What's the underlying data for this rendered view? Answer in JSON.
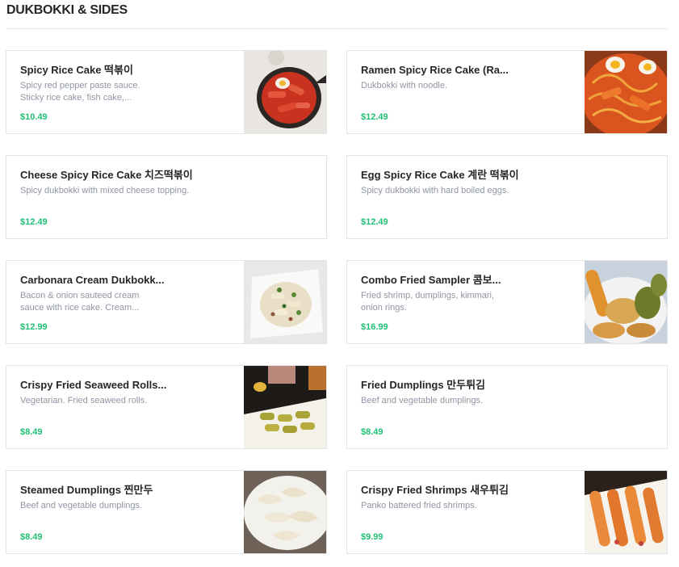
{
  "section": {
    "title": "DUKBOKKI & SIDES"
  },
  "colors": {
    "price": "#1fbf75",
    "border": "#e4e4e4",
    "desc": "#8f95a3"
  },
  "items": [
    {
      "name": "Spicy Rice Cake 떡볶이",
      "desc": "Spicy red pepper paste sauce. Sticky rice cake, fish cake,...",
      "price": "$10.49",
      "image": "tteokbokki-pan-photo"
    },
    {
      "name": "Ramen Spicy Rice Cake (Ra...",
      "desc": "Dukbokki with noodle.",
      "price": "$12.49",
      "image": "rabokki-photo"
    },
    {
      "name": "Cheese Spicy Rice Cake 치즈떡볶이",
      "desc": "Spicy dukbokki with mixed cheese topping.",
      "price": "$12.49",
      "image": null
    },
    {
      "name": "Egg Spicy Rice Cake 계란 떡볶이",
      "desc": "Spicy dukbokki with hard boiled eggs.",
      "price": "$12.49",
      "image": null
    },
    {
      "name": "Carbonara Cream Dukbokk...",
      "desc": "Bacon & onion sauteed cream sauce with rice cake. Cream...",
      "price": "$12.99",
      "image": "carbonara-photo"
    },
    {
      "name": "Combo Fried Sampler 콤보...",
      "desc": "Fried shrimp, dumplings, kimmari, onion rings.",
      "price": "$16.99",
      "image": "fried-sampler-photo"
    },
    {
      "name": "Crispy Fried Seaweed Rolls...",
      "desc": "Vegetarian. Fried seaweed rolls.",
      "price": "$8.49",
      "image": "seaweed-rolls-photo"
    },
    {
      "name": "Fried Dumplings 만두튀김",
      "desc": "Beef and vegetable dumplings.",
      "price": "$8.49",
      "image": null
    },
    {
      "name": "Steamed Dumplings 찐만두",
      "desc": "Beef and vegetable dumplings.",
      "price": "$8.49",
      "image": "steamed-dumplings-photo"
    },
    {
      "name": "Crispy Fried Shrimps 새우튀김",
      "desc": "Panko battered fried shrimps.",
      "price": "$9.99",
      "image": "fried-shrimp-photo"
    }
  ]
}
